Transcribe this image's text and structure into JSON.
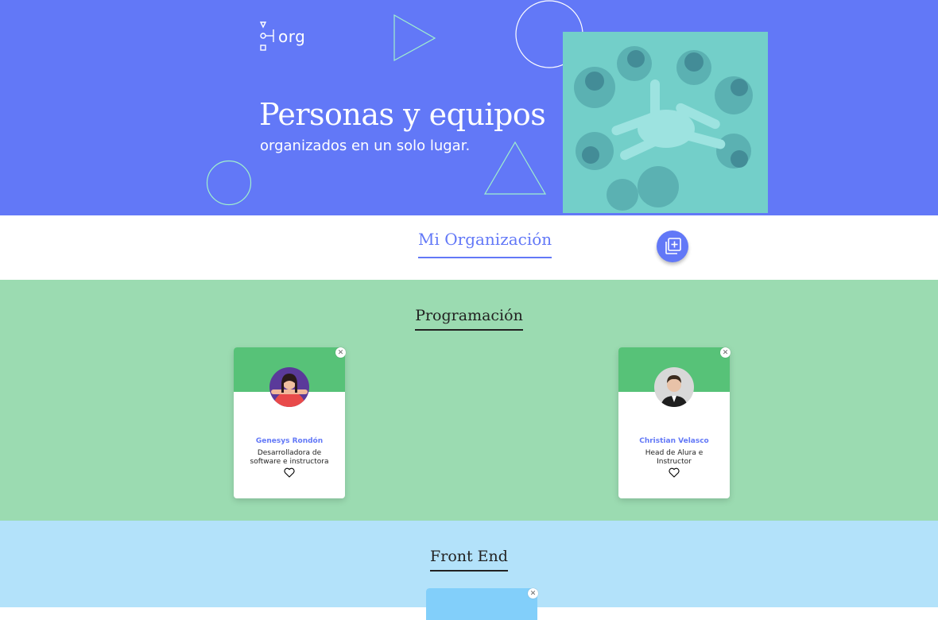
{
  "header": {
    "logo_text": "org",
    "title": "Personas y equipos",
    "subtitle": "organizados en un solo lugar."
  },
  "organization": {
    "title": "Mi Organización",
    "add_icon": "add-layer-icon"
  },
  "teams": [
    {
      "name": "Programación",
      "background": "#9bdbb1",
      "accent": "#57c278",
      "members": [
        {
          "name": "Genesys Rondón",
          "role": "Desarrolladora de software e instructora"
        },
        {
          "name": "Christian Velasco",
          "role": "Head de Alura e Instructor"
        }
      ]
    },
    {
      "name": "Front End",
      "background": "#b3e2fa",
      "accent": "#82cffa",
      "members": []
    }
  ],
  "colors": {
    "primary": "#6278f7",
    "hero_accent": "#a0f0ce"
  }
}
